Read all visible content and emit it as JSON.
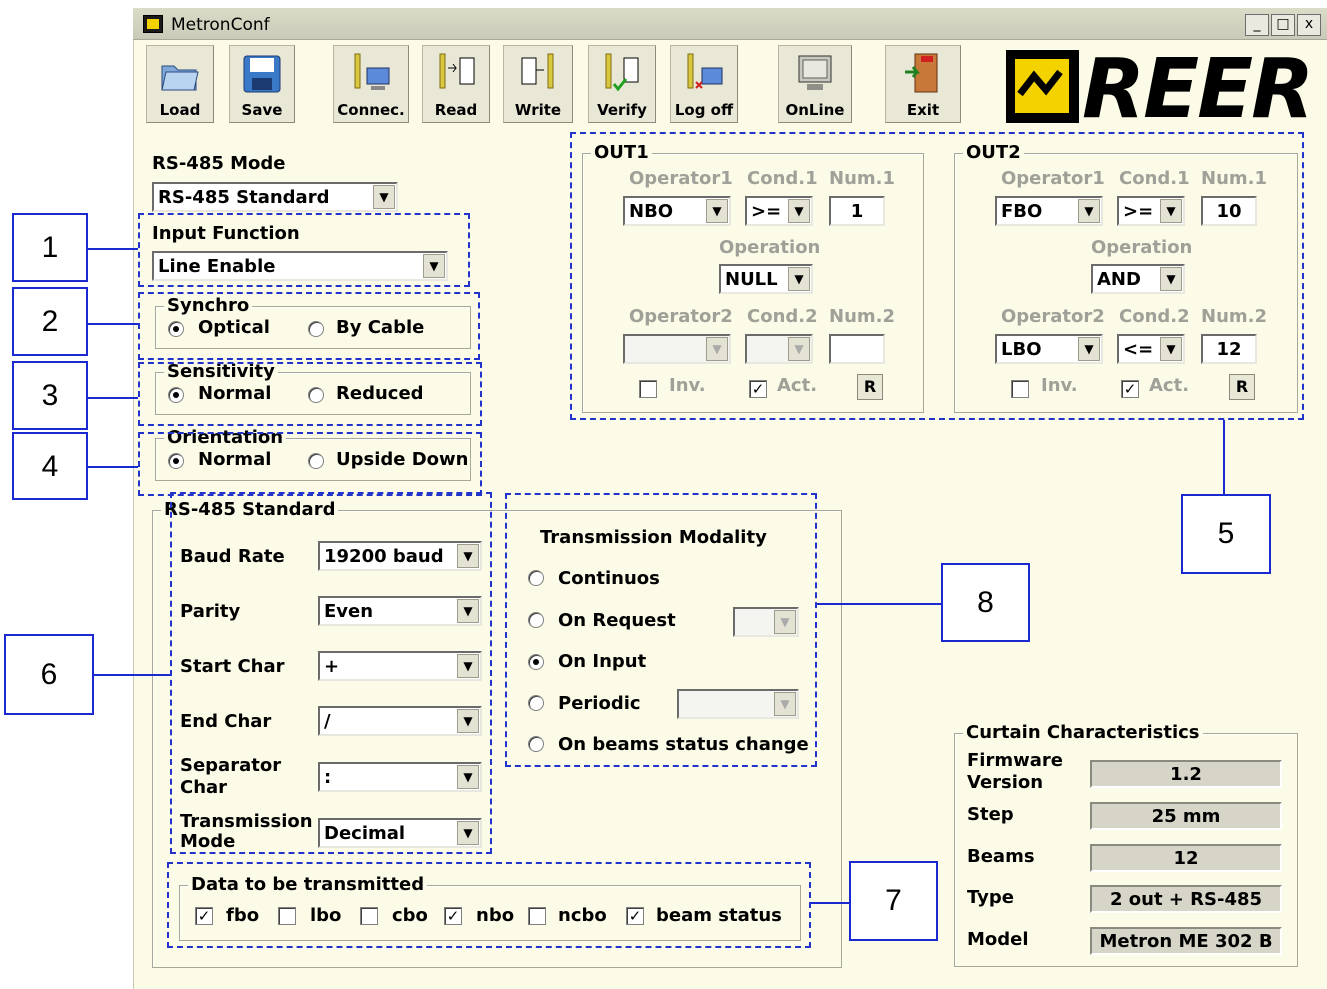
{
  "window": {
    "title": "MetronConf",
    "min": "_",
    "max": "□",
    "close": "x"
  },
  "toolbar": {
    "load": "Load",
    "save": "Save",
    "connect": "Connec.",
    "read": "Read",
    "write": "Write",
    "verify": "Verify",
    "logoff": "Log off",
    "online": "OnLine",
    "exit": "Exit"
  },
  "logo": {
    "text": "REER"
  },
  "rs485_mode": {
    "label": "RS-485 Mode",
    "value": "RS-485 Standard"
  },
  "input_function": {
    "label": "Input Function",
    "value": "Line Enable"
  },
  "synchro": {
    "label": "Synchro",
    "opt1": "Optical",
    "opt2": "By Cable",
    "selected": "Optical"
  },
  "sensitivity": {
    "label": "Sensitivity",
    "opt1": "Normal",
    "opt2": "Reduced",
    "selected": "Normal"
  },
  "orientation": {
    "label": "Orientation",
    "opt1": "Normal",
    "opt2": "Upside Down",
    "selected": "Normal"
  },
  "out1": {
    "label": "OUT1",
    "op1_label": "Operator1",
    "cond1_label": "Cond.1",
    "num1_label": "Num.1",
    "op1": "NBO",
    "cond1": ">=",
    "num1": "1",
    "operation_label": "Operation",
    "operation": "NULL",
    "op2_label": "Operator2",
    "cond2_label": "Cond.2",
    "num2_label": "Num.2",
    "op2": "",
    "cond2": "",
    "num2": "",
    "inv": "Inv.",
    "act": "Act.",
    "reset": "R"
  },
  "out2": {
    "label": "OUT2",
    "op1_label": "Operator1",
    "cond1_label": "Cond.1",
    "num1_label": "Num.1",
    "op1": "FBO",
    "cond1": ">=",
    "num1": "10",
    "operation_label": "Operation",
    "operation": "AND",
    "op2_label": "Operator2",
    "cond2_label": "Cond.2",
    "num2_label": "Num.2",
    "op2": "LBO",
    "cond2": "<=",
    "num2": "12",
    "inv": "Inv.",
    "act": "Act.",
    "reset": "R"
  },
  "rs485_std": {
    "label": "RS-485 Standard",
    "baud_label": "Baud Rate",
    "baud": "19200 baud",
    "parity_label": "Parity",
    "parity": "Even",
    "start_label": "Start Char",
    "start": "+",
    "end_label": "End Char",
    "end": "/",
    "sep_label1": "Separator",
    "sep_label2": "Char",
    "sep": ":",
    "tmode_label1": "Transmission",
    "tmode_label2": "Mode",
    "tmode": "Decimal"
  },
  "modality": {
    "label": "Transmission Modality",
    "continuos": "Continuos",
    "on_request": "On Request",
    "on_input": "On Input",
    "periodic": "Periodic",
    "on_beams": "On beams status change",
    "selected": "On Input"
  },
  "data_tx": {
    "label": "Data to be transmitted",
    "fbo": "fbo",
    "lbo": "lbo",
    "cbo": "cbo",
    "nbo": "nbo",
    "ncbo": "ncbo",
    "beam": "beam status"
  },
  "curtain": {
    "label": "Curtain Characteristics",
    "fw_label1": "Firmware",
    "fw_label2": "Version",
    "fw": "1.2",
    "step_label": "Step",
    "step": "25 mm",
    "beams_label": "Beams",
    "beams": "12",
    "type_label": "Type",
    "type": "2 out + RS-485",
    "model_label": "Model",
    "model": "Metron ME 302 B"
  },
  "callouts": [
    "1",
    "2",
    "3",
    "4",
    "5",
    "6",
    "7",
    "8"
  ],
  "colors": {
    "accent": "#1a2ad0",
    "window_bg": "#fbfbe8",
    "logo_yellow": "#f4d200"
  }
}
